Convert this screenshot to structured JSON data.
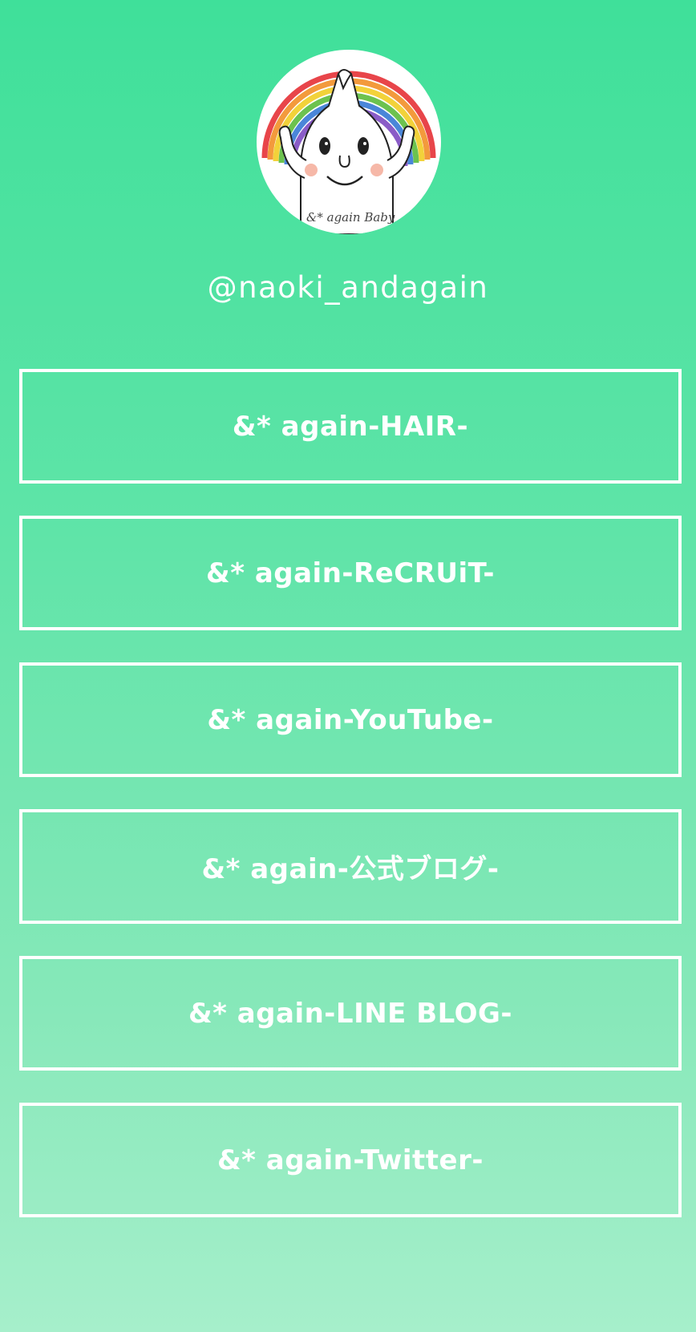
{
  "profile": {
    "avatar_icon": "rainbow-mascot-avatar-icon",
    "avatar_text": "&* again Baby",
    "username": "@naoki_andagain"
  },
  "links": [
    {
      "label": "&* again-HAIR-"
    },
    {
      "label": "&* again-ReCRUiT-"
    },
    {
      "label": "&* again-YouTube-"
    },
    {
      "label": "&* again-公式ブログ-"
    },
    {
      "label": "&* again-LINE BLOG-"
    },
    {
      "label": "&* again-Twitter-"
    }
  ],
  "colors": {
    "gradient_top": "#3fe09a",
    "gradient_bottom": "#a6efcb",
    "text": "#ffffff",
    "button_border": "#ffffff"
  }
}
